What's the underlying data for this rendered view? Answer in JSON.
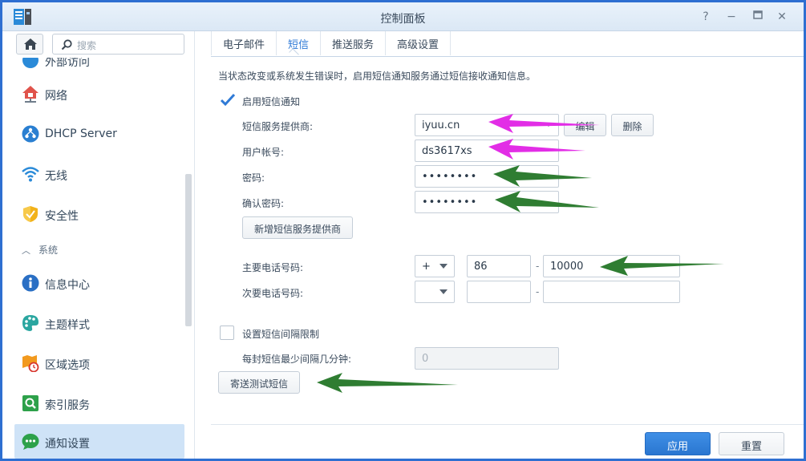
{
  "window": {
    "title": "控制面板"
  },
  "sidebar": {
    "search_placeholder": "搜索",
    "partial_item": "外部访问",
    "items": [
      {
        "label": "网络",
        "icon": "house-network-icon"
      },
      {
        "label": "DHCP Server",
        "icon": "dhcp-icon"
      },
      {
        "label": "无线",
        "icon": "wifi-icon"
      },
      {
        "label": "安全性",
        "icon": "shield-icon"
      }
    ],
    "category": "系统",
    "system_items": [
      {
        "label": "信息中心",
        "icon": "info-icon"
      },
      {
        "label": "主题样式",
        "icon": "palette-icon"
      },
      {
        "label": "区域选项",
        "icon": "region-clock-icon"
      },
      {
        "label": "索引服务",
        "icon": "index-search-icon"
      },
      {
        "label": "通知设置",
        "icon": "chat-bubble-icon",
        "active": true
      }
    ]
  },
  "tabs": [
    {
      "label": "电子邮件"
    },
    {
      "label": "短信",
      "active": true
    },
    {
      "label": "推送服务"
    },
    {
      "label": "高级设置"
    }
  ],
  "sms": {
    "description": "当状态改变或系统发生错误时，启用短信通知服务通过短信接收通知信息。",
    "enable_label": "启用短信通知",
    "enable_checked": true,
    "provider_label": "短信服务提供商:",
    "provider_value": "iyuu.cn",
    "edit_label": "编辑",
    "delete_label": "删除",
    "account_label": "用户帐号:",
    "account_value": "ds3617xs",
    "password_label": "密码:",
    "password_value": "••••••••",
    "confirm_label": "确认密码:",
    "confirm_value": "••••••••",
    "add_provider_label": "新增短信服务提供商",
    "primary_phone_label": "主要电话号码:",
    "primary_sign": "+",
    "primary_country": "86",
    "primary_number": "10000",
    "secondary_phone_label": "次要电话号码:",
    "secondary_sign": "",
    "secondary_country": "",
    "secondary_number": "",
    "dash": "-",
    "interval_label": "设置短信间隔限制",
    "interval_checked": false,
    "interval_min_label": "每封短信最少间隔几分钟:",
    "interval_min_value": "0",
    "send_test_label": "寄送测试短信"
  },
  "footer": {
    "apply_label": "应用",
    "reset_label": "重置"
  },
  "colors": {
    "accent": "#2f7ad6",
    "magenta_arrow": "#e22de6",
    "green_arrow": "#2f7d32"
  }
}
